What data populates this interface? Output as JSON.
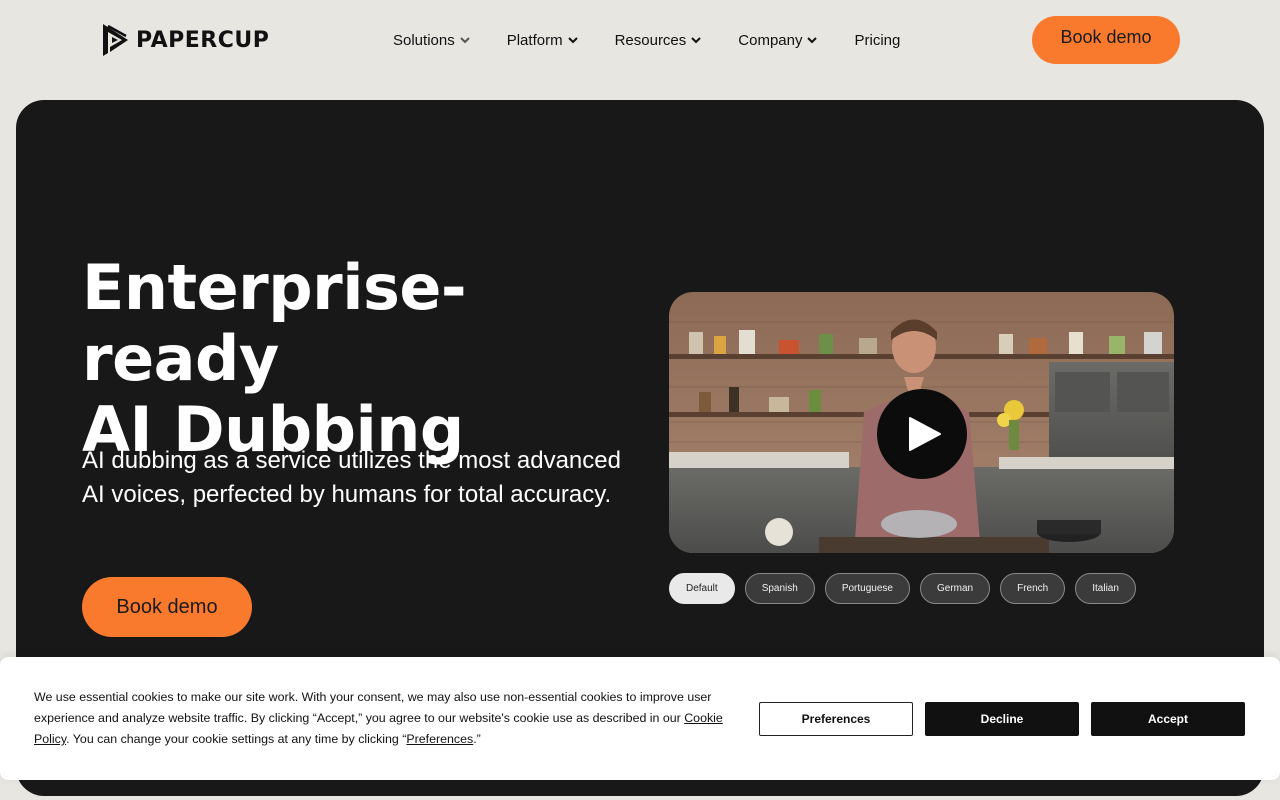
{
  "brand": {
    "name": "PAPERCUP",
    "accent": "#fa7a2d"
  },
  "nav": {
    "items": [
      {
        "label": "Solutions",
        "has_dropdown": true
      },
      {
        "label": "Platform",
        "has_dropdown": true
      },
      {
        "label": "Resources",
        "has_dropdown": true
      },
      {
        "label": "Company",
        "has_dropdown": true
      },
      {
        "label": "Pricing",
        "has_dropdown": false
      }
    ],
    "cta": "Book demo"
  },
  "hero": {
    "title_line1": "Enterprise-ready",
    "title_line2": "AI Dubbing",
    "subtitle": "AI dubbing as a service utilizes the most advanced AI voices, perfected by humans for total accuracy.",
    "cta": "Book demo",
    "video": {
      "play_icon": "play-icon"
    },
    "languages": [
      {
        "label": "Default",
        "active": true
      },
      {
        "label": "Spanish",
        "active": false
      },
      {
        "label": "Portuguese",
        "active": false
      },
      {
        "label": "German",
        "active": false
      },
      {
        "label": "French",
        "active": false
      },
      {
        "label": "Italian",
        "active": false
      }
    ]
  },
  "cookie": {
    "text_before_policy": "We use essential cookies to make our site work. With your consent, we may also use non-essential cookies to improve user experience and analyze website traffic. By clicking “Accept,” you agree to our website's cookie use as described in our ",
    "policy_link": "Cookie Policy",
    "text_middle": ". You can change your cookie settings at any time by clicking “",
    "preferences_link": "Preferences",
    "text_end": ".”",
    "buttons": {
      "preferences": "Preferences",
      "decline": "Decline",
      "accept": "Accept"
    }
  }
}
